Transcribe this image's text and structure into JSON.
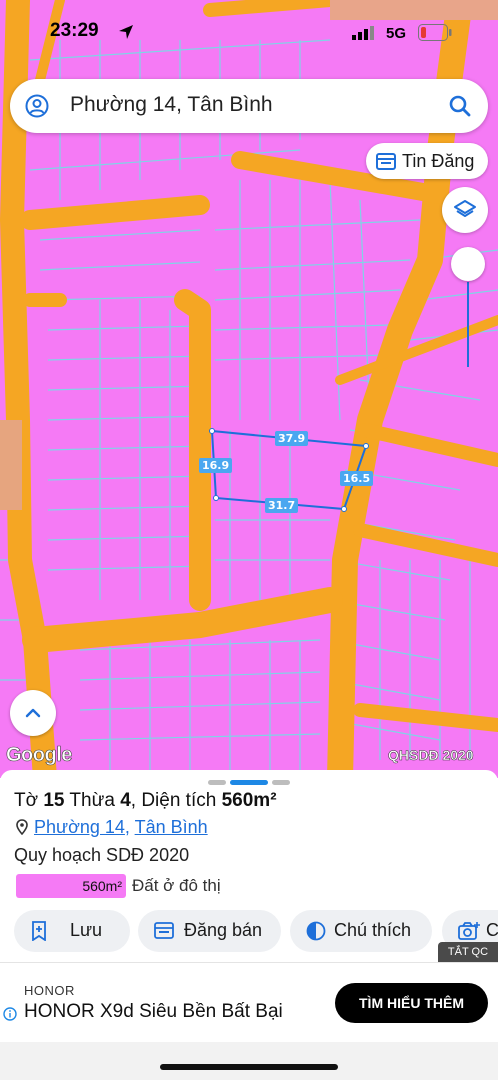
{
  "status_bar": {
    "time": "23:29",
    "network": "5G"
  },
  "search": {
    "query": "Phường 14, Tân Bình"
  },
  "tin_dang_button": {
    "label": "Tin Đăng"
  },
  "map": {
    "parcel_edges": {
      "top": "37.9",
      "left": "16.9",
      "right": "16.5",
      "bottom": "31.7"
    },
    "watermark": "Google",
    "layer_label": "QHSDĐ 2020",
    "land_color": "#f57af5",
    "road_color": "#f5a623",
    "boundary_color": "#7fd4e6"
  },
  "sheet": {
    "title_prefix": "Tờ ",
    "sheet_no": "15",
    "plot_word": " Thừa ",
    "plot_no": "4",
    "area_text": ", Diện tích ",
    "area_value": "560m²",
    "ward": "Phường 14",
    "separator": ", ",
    "district": "Tân Bình",
    "plan_title": "Quy hoạch SDĐ 2020",
    "legend": {
      "area": "560m²",
      "label": "Đất ở đô thị"
    },
    "actions": [
      {
        "label": "Lưu",
        "icon": "bookmark-add-icon"
      },
      {
        "label": "Đăng bán",
        "icon": "calendar-icon"
      },
      {
        "label": "Chú thích",
        "icon": "half-circle-icon"
      },
      {
        "label": "C",
        "icon": "camera-icon"
      }
    ]
  },
  "ad": {
    "close_label": "TẮT QC",
    "brand": "HONOR",
    "headline": "HONOR X9d Siêu Bền Bất Bại",
    "cta": "TÌM HIỂU THÊM"
  }
}
